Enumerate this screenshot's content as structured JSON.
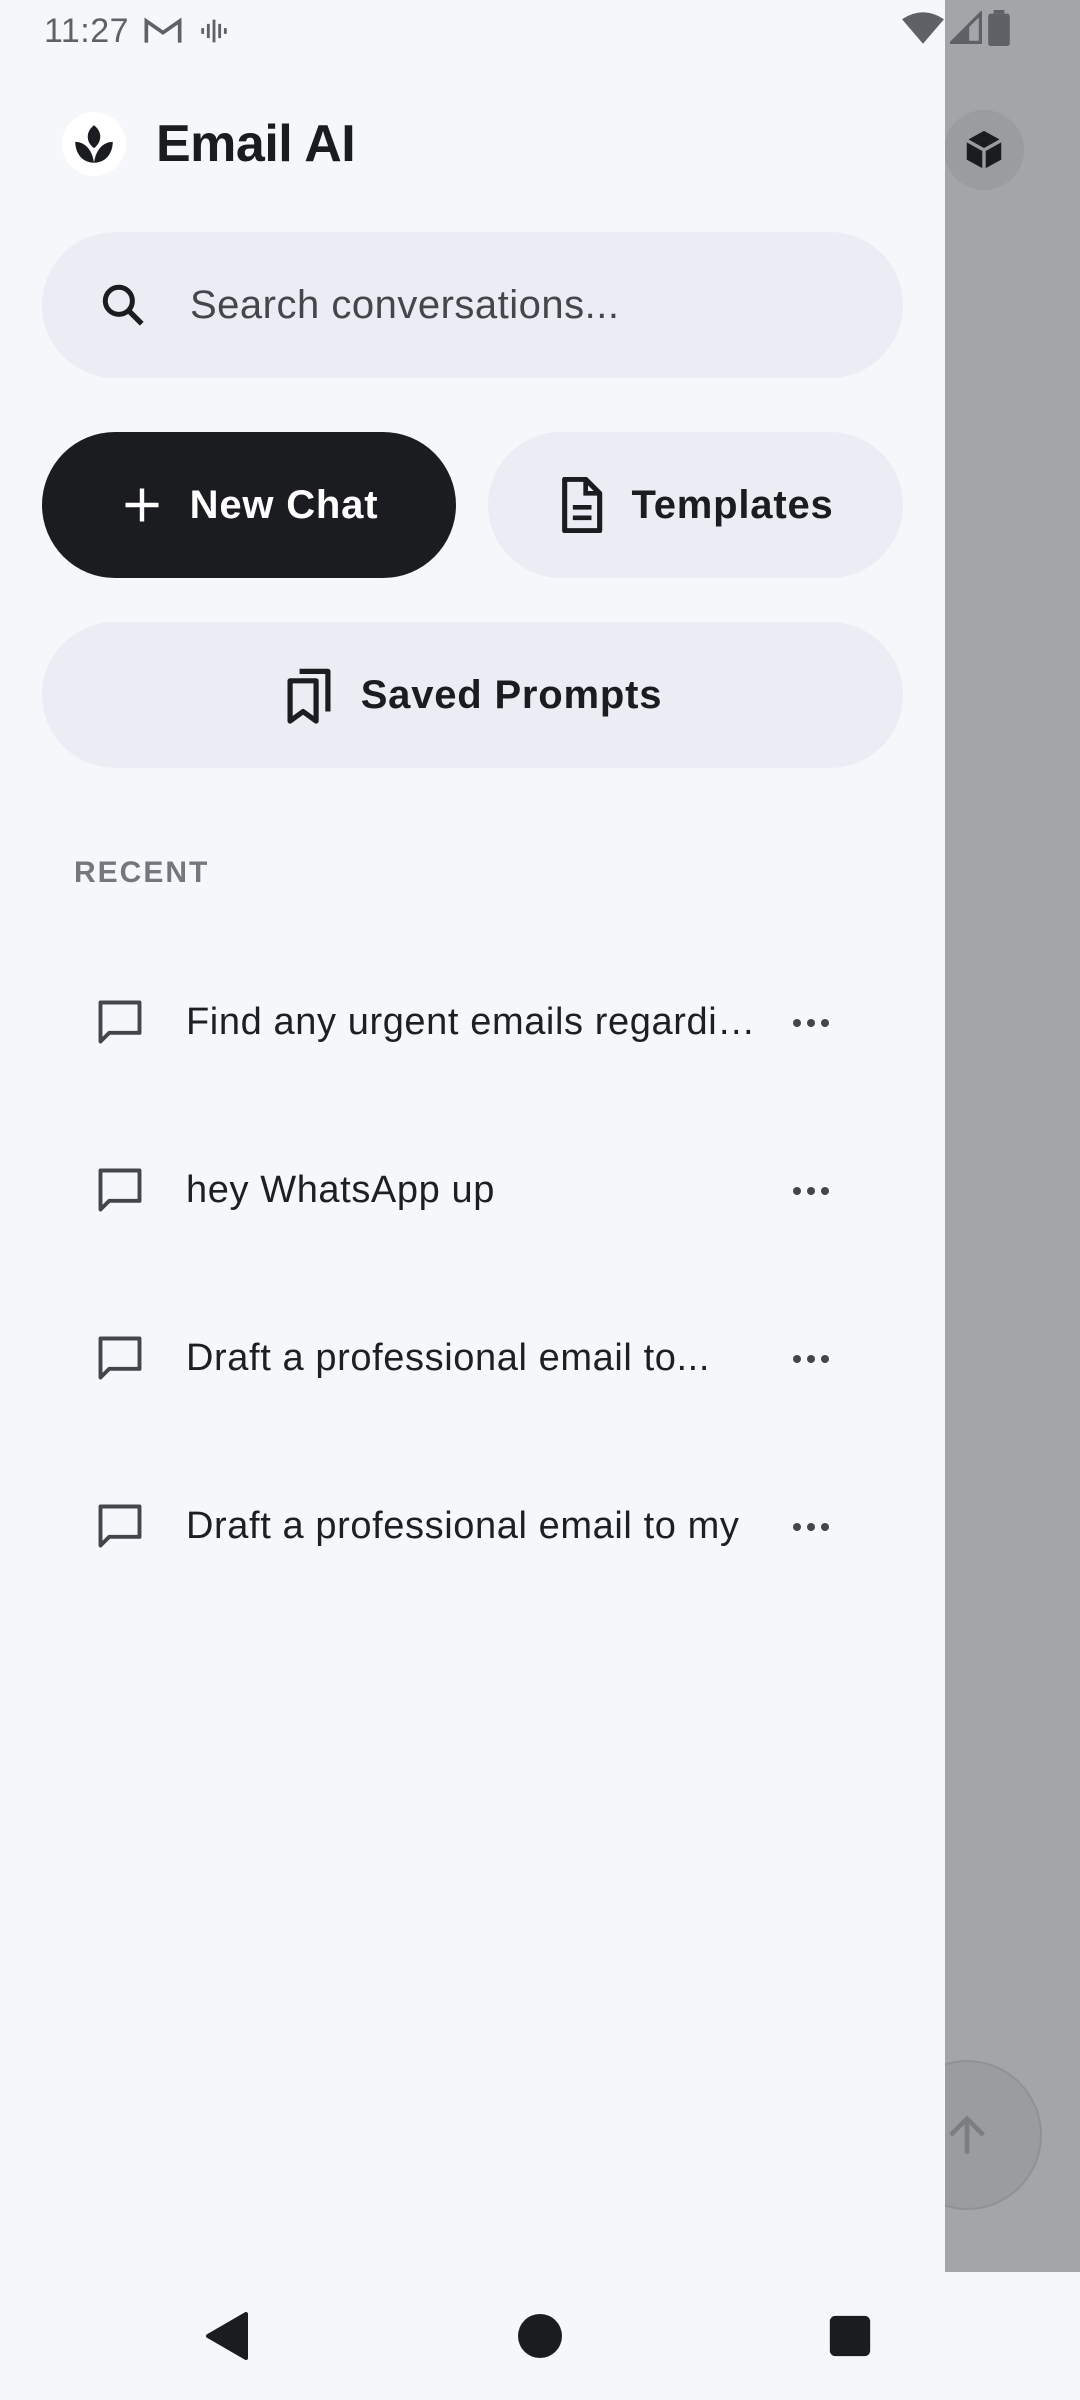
{
  "status_bar": {
    "time": "11:27"
  },
  "app": {
    "name": "Email AI"
  },
  "search": {
    "placeholder": "Search conversations..."
  },
  "actions": {
    "new_chat": "New Chat",
    "templates": "Templates",
    "saved_prompts": "Saved Prompts"
  },
  "recent": {
    "label": "RECENT",
    "items": [
      {
        "title": "Find any urgent emails regarding"
      },
      {
        "title": "hey WhatsApp up"
      },
      {
        "title": "Draft a professional email to..."
      },
      {
        "title": "Draft a professional email to my"
      }
    ]
  },
  "colors": {
    "drawer_bg": "#f6f7fb",
    "primary_button": "#1b1c1f",
    "secondary_button": "#eaedf4",
    "scrim": "#a3a6a9"
  },
  "icons": {
    "status": [
      "gmail-icon",
      "voicemail-icon",
      "wifi-icon",
      "signal-icon",
      "battery-icon"
    ],
    "nav": [
      "back-icon",
      "home-icon",
      "recents-icon"
    ]
  }
}
